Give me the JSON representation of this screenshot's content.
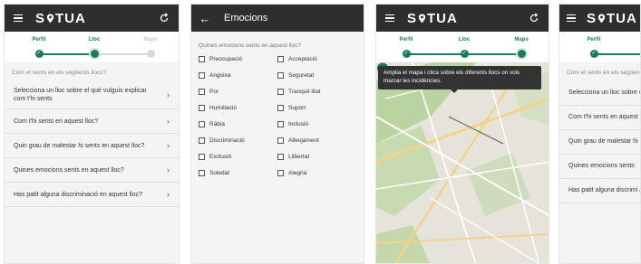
{
  "app": {
    "logo_prefix": "S",
    "logo_suffix": "TUA"
  },
  "steps": [
    "Perfil",
    "Lloc",
    "Maps"
  ],
  "screen1": {
    "question": "Com et sents en els següents llocs?",
    "items": [
      "Selecciona un lloc sobre el què vulguis explicar com t'hi sents",
      "Com t'hi sents en aquest lloc?",
      "Quin grau de malestar hi sents en aquest lloc?",
      "Quines emocions sents en aquest lloc?",
      "Has patit alguna discriminació en aquest lloc?"
    ]
  },
  "screen2": {
    "title": "Emocions",
    "question": "Quines emocions sents en aquest lloc?",
    "emotions": [
      "Preocupació",
      "Acceptació",
      "Angoixa",
      "Seguretat",
      "Por",
      "Tranquil·litat",
      "Humiliació",
      "Suport",
      "Ràbia",
      "Inclusió",
      "Discriminació",
      "Alleujament",
      "Exclusió",
      "Llibertat",
      "Soledat",
      "Alegria"
    ]
  },
  "screen3": {
    "tooltip": "Amplia el mapa i clica sobre els diferents llocs on vols marcar les incidències."
  },
  "screen4": {
    "question": "Com et sents en els següen",
    "items": [
      "Selecciona un lloc sobre explicar com t'hi sents",
      "Com t'hi sents en aquest",
      "Quin grau de malestar hi aquest lloc?",
      "Quines emocions sents",
      "Has patit alguna discrimi aquest lloc?"
    ]
  },
  "colors": {
    "appbar": "#2e2e2e",
    "accent": "#1e7a5a",
    "inactive": "#d8d8d8"
  }
}
